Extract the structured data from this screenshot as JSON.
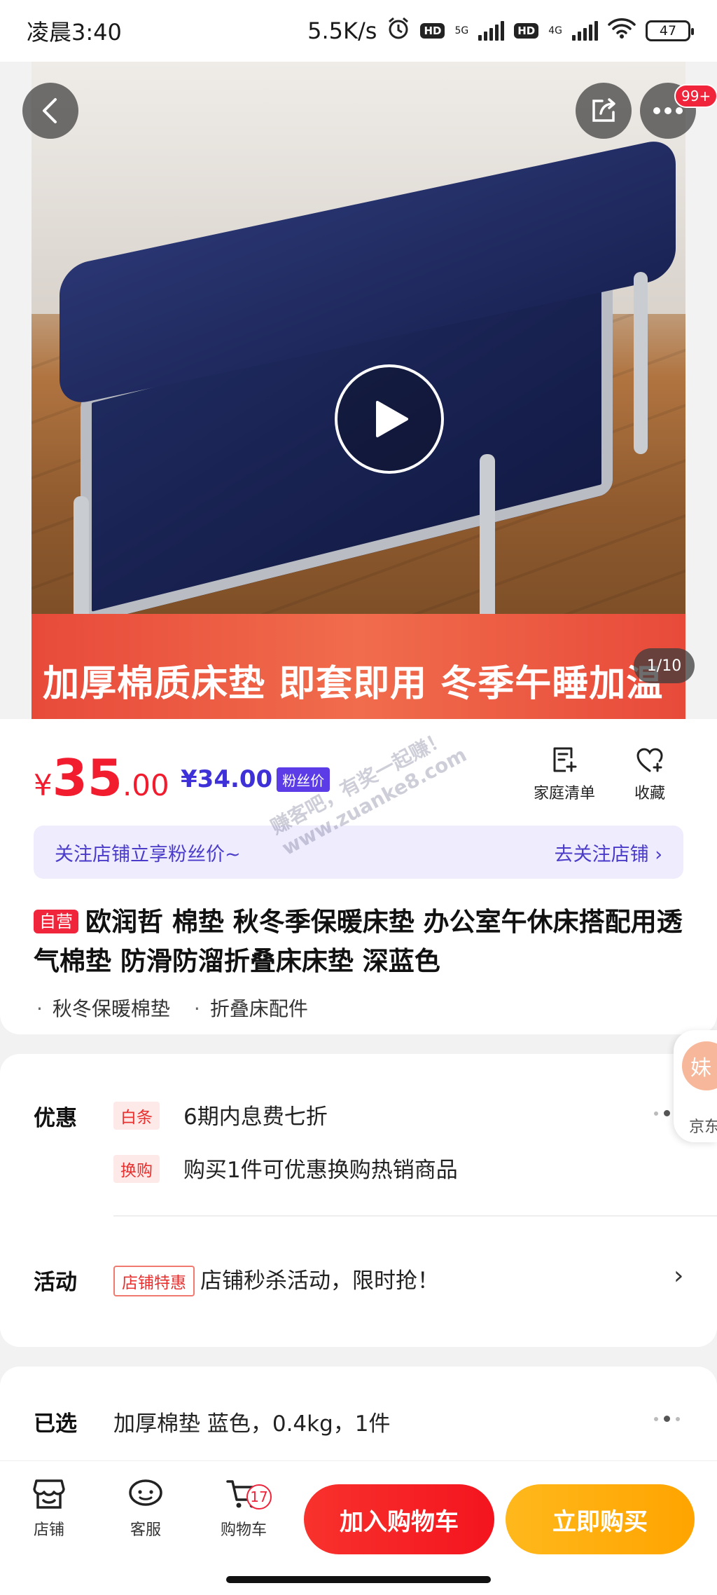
{
  "status_bar": {
    "time": "凌晨3:40",
    "speed": "5.5K/s",
    "hd": "HD",
    "net1": "5G",
    "net2": "4G",
    "battery": "47"
  },
  "hero": {
    "caption": "加厚棉质床垫 即套即用 冬季午睡加温",
    "counter": "1/10",
    "badge": "99+"
  },
  "price": {
    "currency": "¥",
    "integer": "35",
    "decimal": ".00",
    "fans_price": "¥34.00",
    "fans_label": "粉丝价"
  },
  "actions": {
    "list_label": "家庭清单",
    "fav_label": "收藏"
  },
  "follow": {
    "text": "关注店铺立享粉丝价~",
    "link": "去关注店铺 ›"
  },
  "product": {
    "self_tag": "自营",
    "title": "欧润哲 棉垫 秋冬季保暖床垫 办公室午休床搭配用透气棉垫 防滑防溜折叠床床垫 深蓝色",
    "tags": [
      "秋冬保暖棉垫",
      "折叠床配件"
    ]
  },
  "watermark": {
    "line1": "赚客吧，有奖一起赚！",
    "line2": "www.zuanke8.com"
  },
  "promo": {
    "label": "优惠",
    "items": [
      {
        "chip": "白条",
        "text": "6期内息费七折"
      },
      {
        "chip": "换购",
        "text": "购买1件可优惠换购热销商品"
      }
    ]
  },
  "activity": {
    "label": "活动",
    "chip": "店铺特惠",
    "text": "店铺秒杀活动，限时抢！",
    "arrow": "›"
  },
  "floating": {
    "circle": "妹",
    "label": "京东"
  },
  "selected": {
    "label": "已选",
    "text": "加厚棉垫 蓝色，0.4kg，1件"
  },
  "bottom_bar": {
    "store": "店铺",
    "service": "客服",
    "cart": "购物车",
    "cart_count": "17",
    "add_cart": "加入购物车",
    "buy_now": "立即购买"
  },
  "colors": {
    "price_red": "#f21c2f",
    "fans_purple": "#5b3ce6",
    "cart_red": "#f4141e",
    "buy_orange": "#ffa400"
  }
}
